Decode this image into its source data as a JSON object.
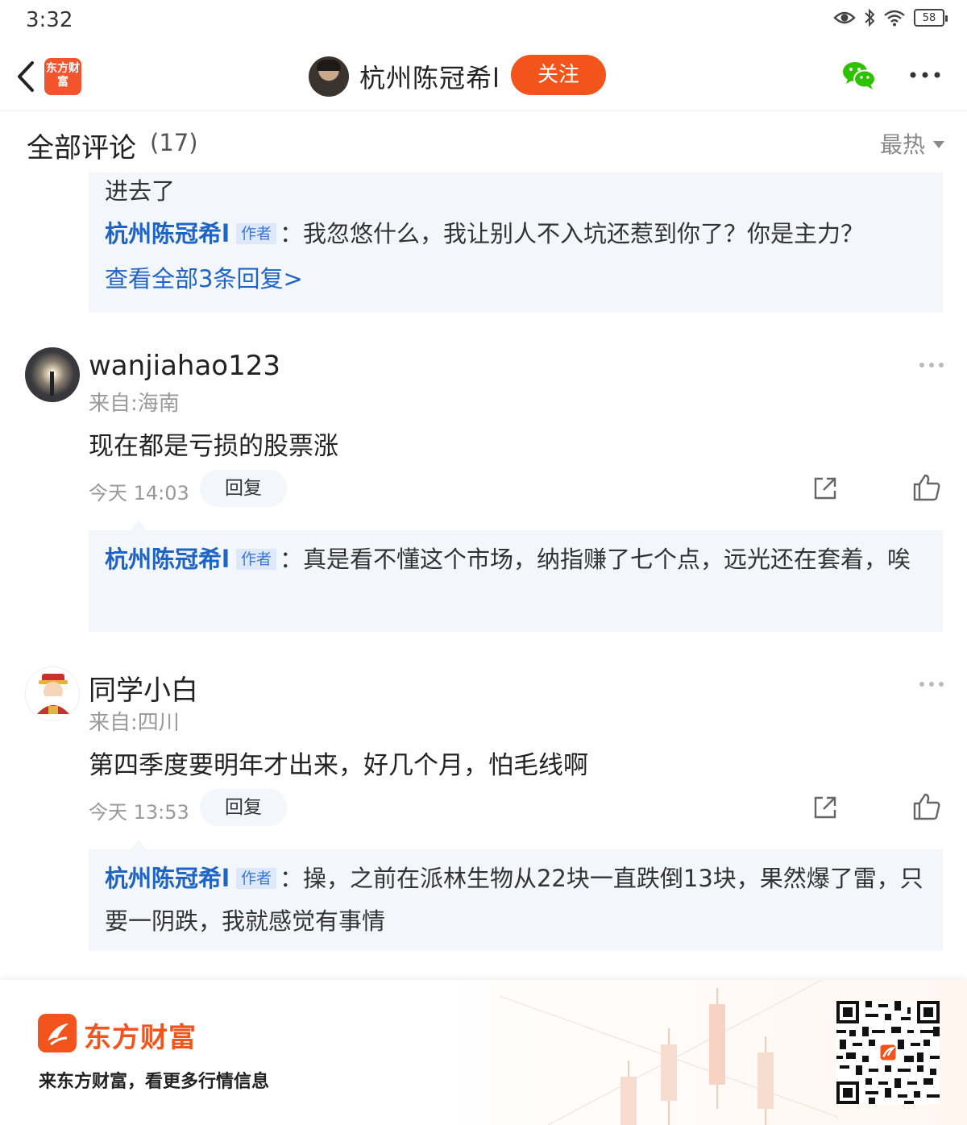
{
  "status_bar": {
    "time": "3:32",
    "battery": "58"
  },
  "nav": {
    "logo_text": "东方财富",
    "title": "杭州陈冠希l",
    "follow_label": "关注",
    "icons": [
      "back-icon",
      "wechat-icon",
      "more-icon"
    ]
  },
  "comments_header": {
    "title": "全部评论",
    "count": "(17)",
    "sort_label": "最热"
  },
  "top_thread": {
    "partial_text": "进去了",
    "reply": {
      "author": "杭州陈冠希l",
      "tag": "作者",
      "separator": "：",
      "text": "我忽悠什么，我让别人不入坑还惹到你了？你是主力？"
    },
    "view_all": "查看全部3条回复>"
  },
  "comments": [
    {
      "username": "wanjiahao123",
      "location": "来自:海南",
      "text": "现在都是亏损的股票涨",
      "time": "今天 14:03",
      "reply_label": "回复",
      "reply": {
        "author": "杭州陈冠希l",
        "tag": "作者",
        "separator": "：",
        "text": "真是看不懂这个市场，纳指赚了七个点，远光还在套着，唉"
      }
    },
    {
      "username": "同学小白",
      "location": "来自:四川",
      "text": "第四季度要明年才出来，好几个月，怕毛线啊",
      "time": "今天 13:53",
      "reply_label": "回复",
      "reply": {
        "author": "杭州陈冠希l",
        "tag": "作者",
        "separator": "：",
        "text": "操，之前在派林生物从22块一直跌倒13块，果然爆了雷，只要一阴跌，我就感觉有事情"
      }
    }
  ],
  "footer": {
    "brand": "东方财富",
    "slogan": "来东方财富，看更多行情信息"
  },
  "colors": {
    "accent": "#f2541b",
    "link": "#1d64c6",
    "reply_bg": "#f3f6fb"
  }
}
